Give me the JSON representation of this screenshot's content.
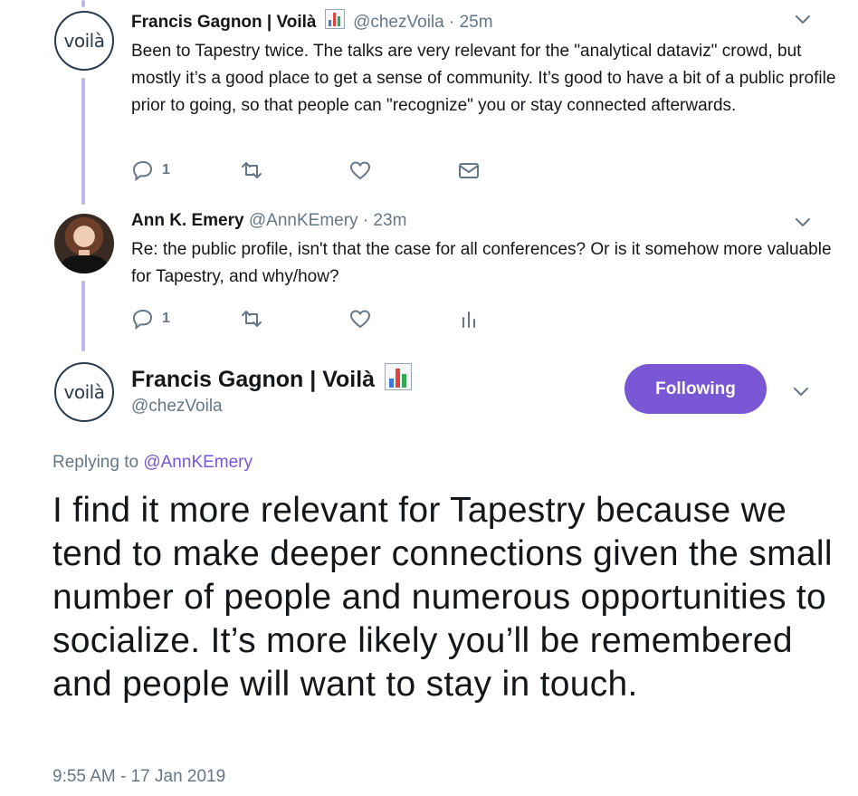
{
  "colors": {
    "accent": "#7856d4",
    "thread_line": "#c4b5e8",
    "muted": "#657786",
    "text": "#14171a"
  },
  "tweet1": {
    "avatar_text": "voilà",
    "name": "Francis Gagnon | Voilà",
    "handle": "@chezVoila",
    "time": "· 25m",
    "text": "Been to Tapestry twice. The talks are very relevant for the \"analytical dataviz\" crowd, but mostly it’s a good place to get a sense of community. It’s good to have a bit of a public profile prior to going, so that people can \"recognize\" you or stay connected afterwards.",
    "reply_count": "1"
  },
  "tweet2": {
    "name": "Ann K. Emery",
    "handle": "@AnnKEmery",
    "time": "· 23m",
    "text": "Re: the public profile, isn't that the case for all conferences? Or is it somehow more valuable for Tapestry, and why/how?",
    "reply_count": "1"
  },
  "main": {
    "avatar_text": "voilà",
    "name": "Francis Gagnon | Voilà",
    "handle": "@chezVoila",
    "follow_label": "Following",
    "replying_prefix": "Replying to",
    "replying_to": "@AnnKEmery",
    "text": "I find it more relevant for Tapestry because we tend to make deeper connections given the small number of people and numerous opportunities to socialize. It’s more likely you’ll be remembered and people will want to stay in touch.",
    "timestamp": "9:55 AM - 17 Jan 2019"
  },
  "icons": [
    "reply-icon",
    "retweet-icon",
    "like-icon",
    "message-icon",
    "analytics-icon",
    "chevron-down-icon",
    "bar-chart-emoji-icon"
  ]
}
